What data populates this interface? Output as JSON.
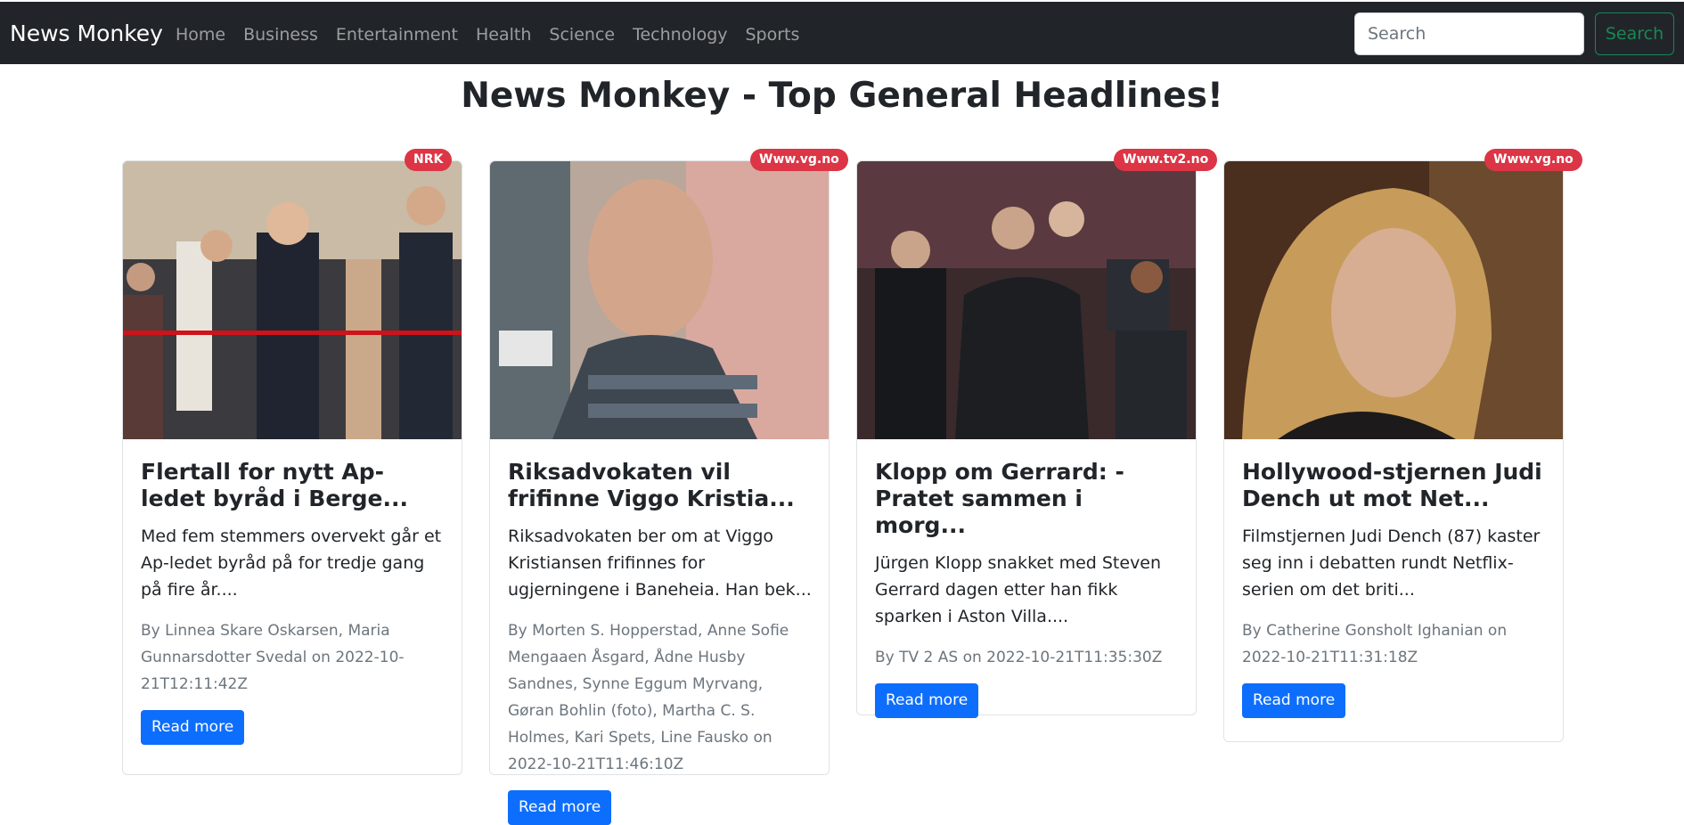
{
  "navbar": {
    "brand": "News Monkey",
    "links": [
      "Home",
      "Business",
      "Entertainment",
      "Health",
      "Science",
      "Technology",
      "Sports"
    ],
    "search_placeholder": "Search",
    "search_button": "Search"
  },
  "main": {
    "title": "News Monkey - Top General Headlines!"
  },
  "cards": [
    {
      "source": "NRK",
      "title": "Flertall for nytt Ap-ledet byråd i Berge...",
      "description": "Med fem stemmers overvekt går et Ap-ledet byråd på for tredje gang på fire år....",
      "meta": "By Linnea Skare Oskarsen, Maria Gunnarsdotter Svedal on 2022-10-21T12:11:42Z",
      "button": "Read more"
    },
    {
      "source": "Www.vg.no",
      "title": "Riksadvokaten vil frifinne Viggo Kristia...",
      "description": "Riksadvokaten ber om at Viggo Kristiansen frifinnes for ugjerningene i Baneheia. Han bek...",
      "meta": "By Morten S. Hopperstad, Anne Sofie Mengaaen Åsgard, Ådne Husby Sandnes, Synne Eggum Myrvang, Gøran Bohlin (foto), Martha C. S. Holmes, Kari Spets, Line Fausko on 2022-10-21T11:46:10Z",
      "button": "Read more"
    },
    {
      "source": "Www.tv2.no",
      "title": "Klopp om Gerrard: - Pratet sammen i morg...",
      "description": "Jürgen Klopp snakket med Steven Gerrard dagen etter han fikk sparken i Aston Villa....",
      "meta": "By TV 2 AS on 2022-10-21T11:35:30Z",
      "button": "Read more"
    },
    {
      "source": "Www.vg.no",
      "title": "Hollywood-stjernen Judi Dench ut mot Net...",
      "description": "Filmstjernen Judi Dench (87) kaster seg inn i debatten rundt Netflix-serien om det briti...",
      "meta": "By Catherine Gonsholt Ighanian on 2022-10-21T11:31:18Z",
      "button": "Read more"
    }
  ]
}
